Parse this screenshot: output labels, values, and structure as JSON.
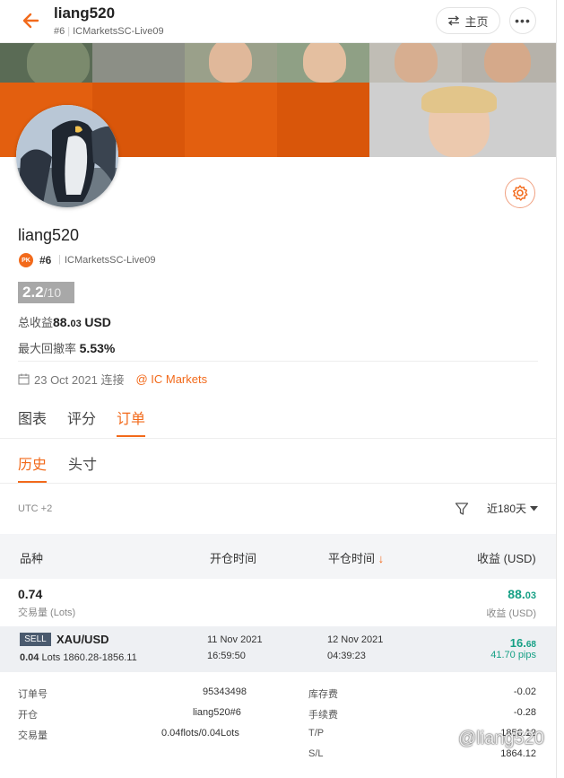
{
  "header": {
    "title": "liang520",
    "rank": "#6",
    "server": "ICMarketsSC-Live09",
    "home_label": "主页",
    "more_label": "•••"
  },
  "profile": {
    "name": "liang520",
    "badge": "PK",
    "rank": "#6",
    "server": "ICMarketsSC-Live09",
    "score": "2.2",
    "score_max": "/10",
    "total_profit_label": "总收益",
    "total_profit_int": "88.",
    "total_profit_dec": "03",
    "total_profit_unit": "USD",
    "max_drawdown_label": "最大回撤率",
    "max_drawdown_value": "5.53%",
    "connected_date": "23 Oct 2021 连接",
    "broker": "@ IC Markets"
  },
  "tabs": [
    "图表",
    "评分",
    "订单"
  ],
  "active_tab": "订单",
  "subtabs": [
    "历史",
    "头寸"
  ],
  "active_subtab": "历史",
  "filter": {
    "timezone": "UTC +2",
    "period": "近180天"
  },
  "table": {
    "headers": {
      "symbol": "品种",
      "open_time": "开仓时间",
      "close_time": "平仓时间",
      "close_sort_arrow": "↓",
      "profit": "收益 (USD)"
    },
    "summary": {
      "volume": "0.74",
      "volume_label": "交易量 (Lots)",
      "profit_int": "88.",
      "profit_dec": "03",
      "profit_label": "收益 (USD)"
    },
    "order": {
      "side": "SELL",
      "symbol": "XAU/USD",
      "lots": "0.04",
      "lots_label": "Lots",
      "price_range": "1860.28-1856.11",
      "open_date": "11 Nov 2021",
      "open_time": "16:59:50",
      "close_date": "12 Nov 2021",
      "close_time": "04:39:23",
      "profit_int": "16.",
      "profit_dec": "68",
      "pips": "41.70 pips"
    },
    "details": {
      "order_no_label": "订单号",
      "order_no": "95343498",
      "open_label": "开仓",
      "open_value": "liang520#6",
      "volume_label": "交易量",
      "volume_value": "0.04flots/0.04Lots",
      "swap_label": "库存费",
      "swap_value": "-0.02",
      "commission_label": "手续费",
      "commission_value": "-0.28",
      "tp_label": "T/P",
      "tp_value": "1856.12",
      "sl_label": "S/L",
      "sl_value": "1864.12"
    }
  },
  "watermark": "@liang520",
  "colors": {
    "accent": "#f26a1b",
    "profit_green": "#16a085",
    "sell_tag": "#4a5a6e"
  }
}
